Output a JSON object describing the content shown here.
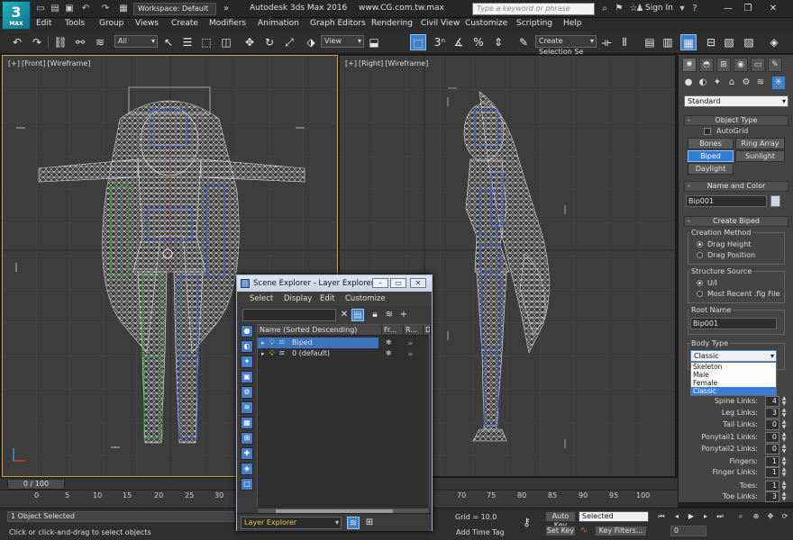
{
  "titlebar": {
    "logo_text": "3",
    "logo_sub": "MAX",
    "workspace": "Workspace: Default",
    "app_title": "Autodesk 3ds Max 2016",
    "url": "www.CG.com.tw.max",
    "search_placeholder": "Type a keyword or phrase",
    "sign_in": "Sign In"
  },
  "menu": [
    "Edit",
    "Tools",
    "Group",
    "Views",
    "Create",
    "Modifiers",
    "Animation",
    "Graph Editors",
    "Rendering",
    "Civil View",
    "Customize",
    "Scripting",
    "Help"
  ],
  "toolbar": {
    "filter": "All",
    "ref_coord": "View",
    "snap_label": "3",
    "selection_set": "Create Selection Se"
  },
  "viewports": {
    "front": {
      "plus": "[+]",
      "view": "[Front]",
      "shading": "[Wireframe]"
    },
    "right": {
      "plus": "[+]",
      "view": "[Right]",
      "shading": "[Wireframe]"
    }
  },
  "command_panel": {
    "category": "Standard",
    "object_type": {
      "title": "Object Type",
      "autogrid": "AutoGrid",
      "buttons": [
        "Bones",
        "Ring Array",
        "Biped",
        "Sunlight",
        "Daylight"
      ],
      "active": "Biped"
    },
    "name_color": {
      "title": "Name and Color",
      "name": "Bip001",
      "color": "#c8d9ef"
    },
    "create_biped": {
      "title": "Create Biped",
      "creation_method": "Creation Method",
      "methods": [
        "Drag Height",
        "Drag Position"
      ],
      "structure_source": "Structure Source",
      "sources": [
        "U/I",
        "Most Recent .fig File"
      ],
      "root_name_label": "Root Name",
      "root_name": "Bip001",
      "body_type_label": "Body Type",
      "body_type": "Classic",
      "body_type_options": [
        "Skeleton",
        "Male",
        "Female",
        "Classic"
      ]
    },
    "links": [
      {
        "label": "Spine Links:",
        "value": "4"
      },
      {
        "label": "Leg Links:",
        "value": "3"
      },
      {
        "label": "Tail Links:",
        "value": "0"
      },
      {
        "label": "Ponytail1 Links:",
        "value": "0"
      },
      {
        "label": "Ponytail2 Links:",
        "value": "0"
      },
      {
        "label": "Fingers:",
        "value": "1"
      },
      {
        "label": "Finger Links:",
        "value": "1"
      },
      {
        "label": "Toes:",
        "value": "1"
      },
      {
        "label": "Toe Links:",
        "value": "3"
      }
    ]
  },
  "scene_explorer": {
    "title": "Scene Explorer - Layer Explorer",
    "menu": [
      "Select",
      "Display",
      "Edit",
      "Customize"
    ],
    "columns": [
      "Name (Sorted Descending)",
      "Fr...",
      "R...",
      "D"
    ],
    "rows": [
      {
        "name": "Biped",
        "selected": true
      },
      {
        "name": "0 (default)",
        "selected": false
      }
    ],
    "footer": "Layer Explorer"
  },
  "timeline": {
    "position": "0 / 100",
    "ticks": [
      "0",
      "5",
      "10",
      "15",
      "20",
      "25",
      "30",
      "70",
      "75",
      "80",
      "85",
      "90",
      "95",
      "100"
    ]
  },
  "status": {
    "selection": "1 Object Selected",
    "prompt": "Click or click-and-drag to select objects",
    "grid": "Grid = 10.0",
    "add_time_tag": "Add Time Tag",
    "auto_key": "Auto Key",
    "set_key": "Set Key",
    "key_mode": "Selected",
    "key_filters": "Key Filters...",
    "frame": "0"
  }
}
